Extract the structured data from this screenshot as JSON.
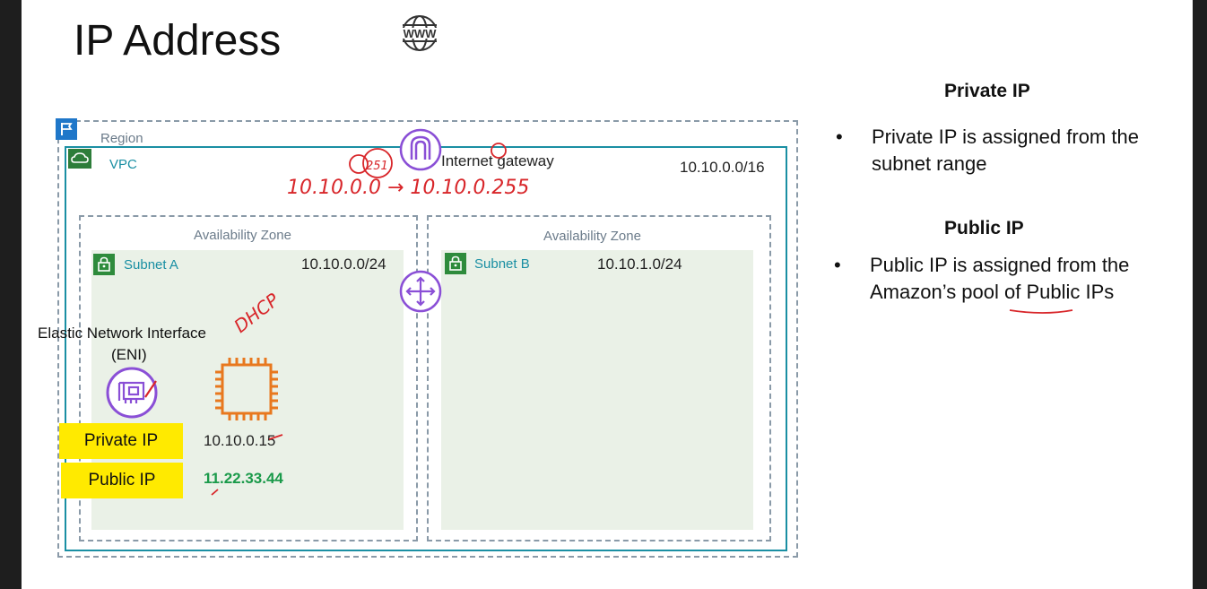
{
  "slide": {
    "title": "IP Address"
  },
  "diagram": {
    "region_label": "Region",
    "vpc_label": "VPC",
    "vpc_cidr": "10.10.0.0/16",
    "igw_label": "Internet gateway",
    "az_a_label": "Availability Zone",
    "az_b_label": "Availability Zone",
    "subnet_a_label": "Subnet A",
    "subnet_a_cidr": "10.10.0.0/24",
    "subnet_b_label": "Subnet B",
    "subnet_b_cidr": "10.10.1.0/24",
    "eni_label_1": "Elastic Network Interface",
    "eni_label_2": "(ENI)",
    "private_tag": "Private IP",
    "private_ip": "10.10.0.15",
    "public_tag": "Public IP",
    "public_ip": "11.22.33.44"
  },
  "side": {
    "private_heading": "Private IP",
    "private_bullets": [
      "Private IP is assigned from the subnet range"
    ],
    "public_heading": "Public IP",
    "public_bullets": [
      "Public IP is assigned from the Amazon’s pool of Public IPs"
    ],
    "bullet_char": "•"
  },
  "handwriting": {
    "range": "10.10.0.0 → 10.10.0.255",
    "count": "251",
    "note": "DHCP"
  },
  "colors": {
    "aws_teal": "#1a8fa3",
    "ink_red": "#d8262a",
    "purple": "#8a4fd6",
    "orange": "#e8781e",
    "highlight": "#ffea00",
    "public_green": "#1a9a4a"
  },
  "icons": {
    "www": "globe-www-icon",
    "region": "region-flag-icon",
    "vpc": "vpc-cloud-icon",
    "subnet": "subnet-lock-icon",
    "igw": "internet-gateway-icon",
    "router": "router-icon",
    "eni": "eni-icon",
    "instance": "ec2-chip-icon"
  }
}
